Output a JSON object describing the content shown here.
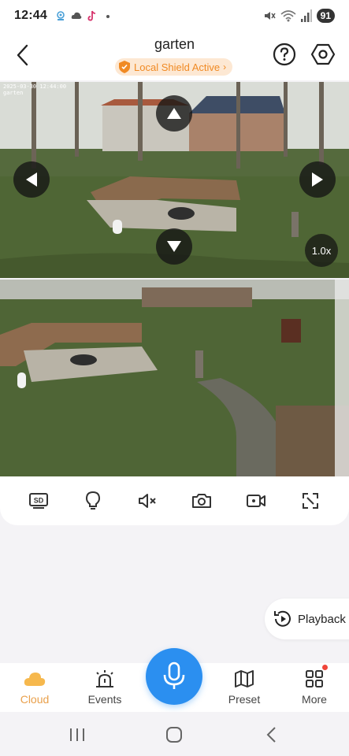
{
  "status_bar": {
    "time": "12:44",
    "battery": "91",
    "notification_icons": [
      "camera-app-icon",
      "cloud-icon",
      "tiktok-icon",
      "more-dot-icon"
    ],
    "system_icons": [
      "mute-icon",
      "wifi-icon",
      "signal-icon"
    ]
  },
  "header": {
    "title": "garten",
    "shield_label": "Local Shield Active",
    "shield_chevron": "›"
  },
  "cameras": [
    {
      "timestamp": "2025-03-30 12:44:00",
      "name": "garten",
      "zoom": "1.0x"
    },
    {
      "timestamp": "",
      "name": ""
    }
  ],
  "toolbar": {
    "items": [
      "sd-icon",
      "light-bulb-icon",
      "mute-icon",
      "snapshot-camera-icon",
      "record-video-icon",
      "fullscreen-icon"
    ]
  },
  "playback": {
    "label": "Playback"
  },
  "bottom_nav": {
    "items": [
      {
        "label": "Cloud",
        "icon": "cloud-icon",
        "active": true
      },
      {
        "label": "Events",
        "icon": "alarm-icon",
        "active": false
      },
      {
        "label": "Preset",
        "icon": "map-icon",
        "active": false
      },
      {
        "label": "More",
        "icon": "grid-icon",
        "active": false
      }
    ]
  },
  "colors": {
    "accent_blue": "#2b8ff0",
    "active_orange": "#e9a04b",
    "shield_orange": "#f08a24",
    "badge_red": "#f0453a"
  }
}
